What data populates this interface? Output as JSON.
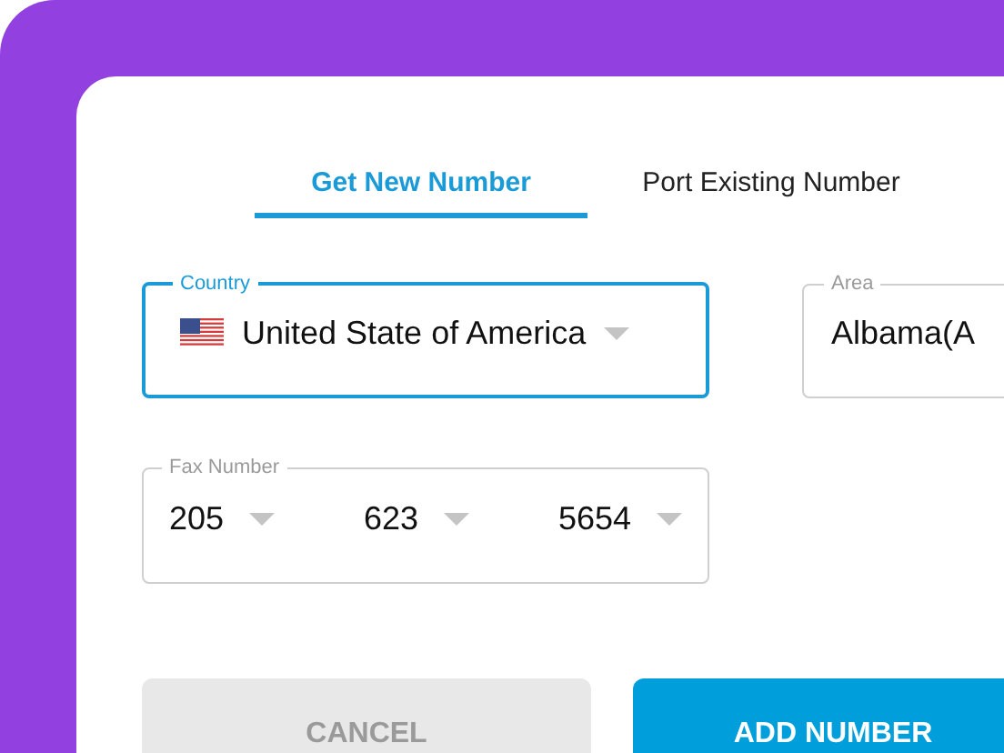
{
  "tabs": [
    {
      "label": "Get New Number",
      "selected": true
    },
    {
      "label": "Port Existing Number",
      "selected": false
    }
  ],
  "country": {
    "label": "Country",
    "value": "United State of America",
    "focused": true
  },
  "area": {
    "label": "Area",
    "value": "Albama(A",
    "focused": false
  },
  "fax_number": {
    "label": "Fax Number",
    "parts": [
      "205",
      "623",
      "5654"
    ],
    "focused": false
  },
  "buttons": [
    {
      "label": "CANCEL",
      "kind": "secondary"
    },
    {
      "label": "ADD NUMBER",
      "kind": "primary"
    }
  ]
}
